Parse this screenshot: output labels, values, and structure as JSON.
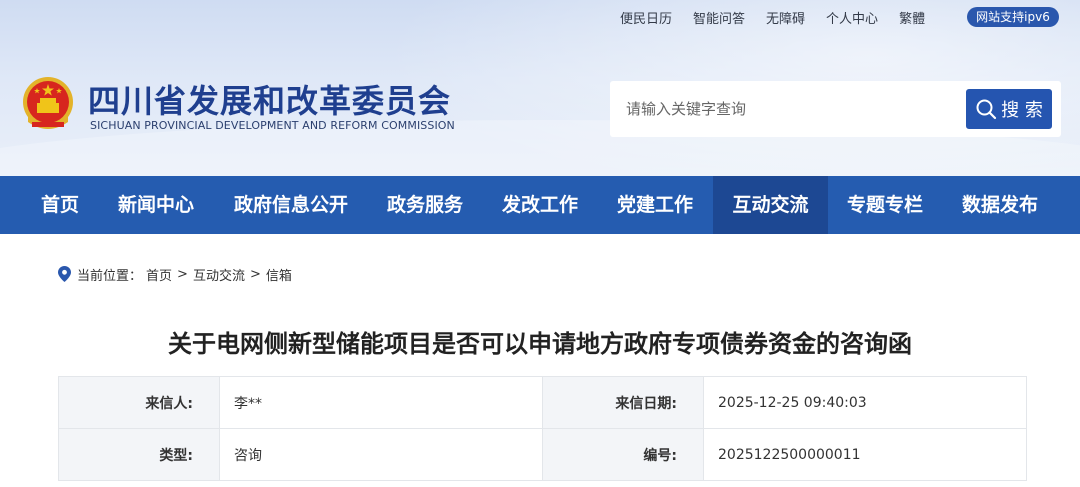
{
  "top_links": [
    "便民日历",
    "智能问答",
    "无障碍",
    "个人中心",
    "繁體"
  ],
  "ipv6_badge": "网站支持ipv6",
  "site": {
    "title_cn": "四川省发展和改革委员会",
    "title_en": "SICHUAN PROVINCIAL DEVELOPMENT AND REFORM COMMISSION",
    "emblem_icon": "national-emblem-icon"
  },
  "search": {
    "placeholder": "请输入关键字查询",
    "button_label": "搜 索",
    "icon": "search-icon"
  },
  "nav": {
    "items": [
      "首页",
      "新闻中心",
      "政府信息公开",
      "政务服务",
      "发改工作",
      "党建工作",
      "互动交流",
      "专题专栏",
      "数据发布"
    ],
    "active": "互动交流"
  },
  "breadcrumb": {
    "icon": "location-pin-icon",
    "prefix": "当前位置：",
    "items": [
      "首页",
      "互动交流",
      "信箱"
    ],
    "separator": ">"
  },
  "letter": {
    "title": "关于电网侧新型储能项目是否可以申请地方政府专项债券资金的咨询函",
    "rows": [
      {
        "label1": "来信人:",
        "value1": "李**",
        "label2": "来信日期:",
        "value2": "2025-12-25 09:40:03"
      },
      {
        "label1": "类型:",
        "value1": "咨询",
        "label2": "编号:",
        "value2": "2025122500000011"
      }
    ]
  },
  "colors": {
    "brand_blue": "#255cb0",
    "nav_active": "#1d4893",
    "title_blue": "#1f3f8f",
    "emblem_red": "#d7261e",
    "emblem_gold": "#f0c419"
  }
}
